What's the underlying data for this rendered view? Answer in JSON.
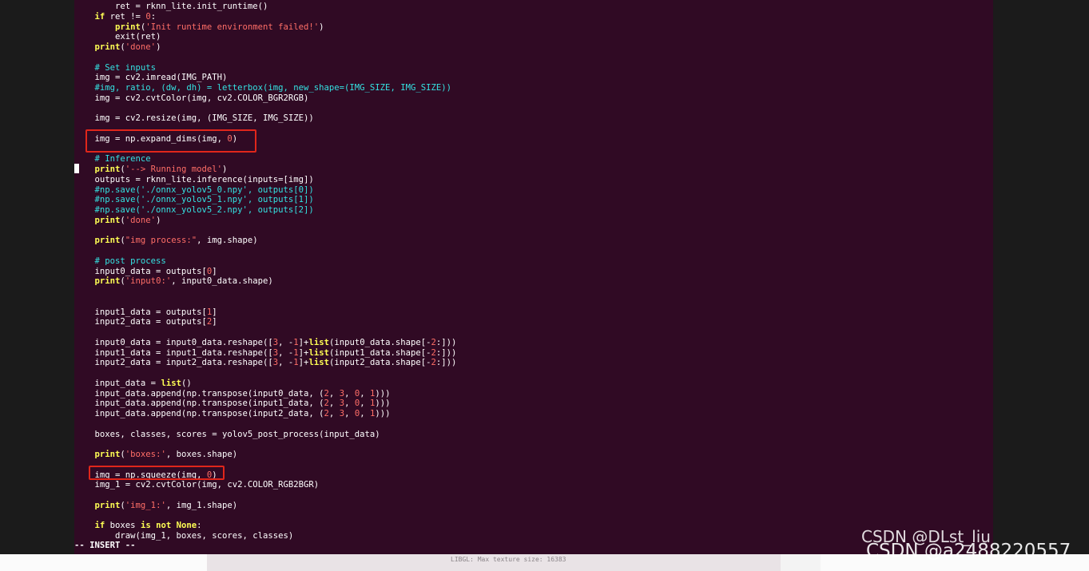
{
  "editor": {
    "mode": "-- INSERT --",
    "lines": [
      [
        {
          "t": "plain",
          "v": "        ret = rknn_lite.init_runtime()"
        }
      ],
      [
        {
          "t": "plain",
          "v": "    "
        },
        {
          "t": "kw",
          "v": "if"
        },
        {
          "t": "plain",
          "v": " ret != "
        },
        {
          "t": "num",
          "v": "0"
        },
        {
          "t": "plain",
          "v": ":"
        }
      ],
      [
        {
          "t": "plain",
          "v": "        "
        },
        {
          "t": "kw",
          "v": "print"
        },
        {
          "t": "plain",
          "v": "("
        },
        {
          "t": "str",
          "v": "'Init runtime environment failed!'"
        },
        {
          "t": "plain",
          "v": ")"
        }
      ],
      [
        {
          "t": "plain",
          "v": "        exit(ret)"
        }
      ],
      [
        {
          "t": "plain",
          "v": "    "
        },
        {
          "t": "kw",
          "v": "print"
        },
        {
          "t": "plain",
          "v": "("
        },
        {
          "t": "str",
          "v": "'done'"
        },
        {
          "t": "plain",
          "v": ")"
        }
      ],
      [],
      [
        {
          "t": "plain",
          "v": "    "
        },
        {
          "t": "cm",
          "v": "# Set inputs"
        }
      ],
      [
        {
          "t": "plain",
          "v": "    img = cv2.imread(IMG_PATH)"
        }
      ],
      [
        {
          "t": "plain",
          "v": "    "
        },
        {
          "t": "cm",
          "v": "#img, ratio, (dw, dh) = letterbox(img, new_shape=(IMG_SIZE, IMG_SIZE))"
        }
      ],
      [
        {
          "t": "plain",
          "v": "    img = cv2.cvtColor(img, cv2.COLOR_BGR2RGB)"
        }
      ],
      [],
      [
        {
          "t": "plain",
          "v": "    img = cv2.resize(img, (IMG_SIZE, IMG_SIZE))"
        }
      ],
      [],
      [
        {
          "t": "plain",
          "v": "    img = np.expand_dims(img, "
        },
        {
          "t": "num",
          "v": "0"
        },
        {
          "t": "plain",
          "v": ")"
        }
      ],
      [],
      [
        {
          "t": "plain",
          "v": "    "
        },
        {
          "t": "cm",
          "v": "# Inference"
        }
      ],
      [
        {
          "t": "plain",
          "v": "    "
        },
        {
          "t": "kw",
          "v": "print"
        },
        {
          "t": "plain",
          "v": "("
        },
        {
          "t": "str",
          "v": "'--> Running model'"
        },
        {
          "t": "plain",
          "v": ")"
        }
      ],
      [
        {
          "t": "plain",
          "v": "    outputs = rknn_lite.inference(inputs=[img])"
        }
      ],
      [
        {
          "t": "plain",
          "v": "    "
        },
        {
          "t": "cm",
          "v": "#np.save('./onnx_yolov5_0.npy', outputs[0])"
        }
      ],
      [
        {
          "t": "plain",
          "v": "    "
        },
        {
          "t": "cm",
          "v": "#np.save('./onnx_yolov5_1.npy', outputs[1])"
        }
      ],
      [
        {
          "t": "plain",
          "v": "    "
        },
        {
          "t": "cm",
          "v": "#np.save('./onnx_yolov5_2.npy', outputs[2])"
        }
      ],
      [
        {
          "t": "plain",
          "v": "    "
        },
        {
          "t": "kw",
          "v": "print"
        },
        {
          "t": "plain",
          "v": "("
        },
        {
          "t": "str",
          "v": "'done'"
        },
        {
          "t": "plain",
          "v": ")"
        }
      ],
      [],
      [
        {
          "t": "plain",
          "v": "    "
        },
        {
          "t": "kw",
          "v": "print"
        },
        {
          "t": "plain",
          "v": "("
        },
        {
          "t": "str",
          "v": "\"img process:\""
        },
        {
          "t": "plain",
          "v": ", img.shape)"
        }
      ],
      [],
      [
        {
          "t": "plain",
          "v": "    "
        },
        {
          "t": "cm",
          "v": "# post process"
        }
      ],
      [
        {
          "t": "plain",
          "v": "    input0_data = outputs["
        },
        {
          "t": "num",
          "v": "0"
        },
        {
          "t": "plain",
          "v": "]"
        }
      ],
      [
        {
          "t": "plain",
          "v": "    "
        },
        {
          "t": "kw",
          "v": "print"
        },
        {
          "t": "plain",
          "v": "("
        },
        {
          "t": "str",
          "v": "'input0:'"
        },
        {
          "t": "plain",
          "v": ", input0_data.shape)"
        }
      ],
      [],
      [],
      [
        {
          "t": "plain",
          "v": "    input1_data = outputs["
        },
        {
          "t": "num",
          "v": "1"
        },
        {
          "t": "plain",
          "v": "]"
        }
      ],
      [
        {
          "t": "plain",
          "v": "    input2_data = outputs["
        },
        {
          "t": "num",
          "v": "2"
        },
        {
          "t": "plain",
          "v": "]"
        }
      ],
      [],
      [
        {
          "t": "plain",
          "v": "    input0_data = input0_data.reshape(["
        },
        {
          "t": "num",
          "v": "3"
        },
        {
          "t": "plain",
          "v": ", -"
        },
        {
          "t": "num",
          "v": "1"
        },
        {
          "t": "plain",
          "v": "]+"
        },
        {
          "t": "kw",
          "v": "list"
        },
        {
          "t": "plain",
          "v": "(input0_data.shape[-"
        },
        {
          "t": "num",
          "v": "2"
        },
        {
          "t": "plain",
          "v": ":]))"
        }
      ],
      [
        {
          "t": "plain",
          "v": "    input1_data = input1_data.reshape(["
        },
        {
          "t": "num",
          "v": "3"
        },
        {
          "t": "plain",
          "v": ", -"
        },
        {
          "t": "num",
          "v": "1"
        },
        {
          "t": "plain",
          "v": "]+"
        },
        {
          "t": "kw",
          "v": "list"
        },
        {
          "t": "plain",
          "v": "(input1_data.shape[-"
        },
        {
          "t": "num",
          "v": "2"
        },
        {
          "t": "plain",
          "v": ":]))"
        }
      ],
      [
        {
          "t": "plain",
          "v": "    input2_data = input2_data.reshape(["
        },
        {
          "t": "num",
          "v": "3"
        },
        {
          "t": "plain",
          "v": ", -"
        },
        {
          "t": "num",
          "v": "1"
        },
        {
          "t": "plain",
          "v": "]+"
        },
        {
          "t": "kw",
          "v": "list"
        },
        {
          "t": "plain",
          "v": "(input2_data.shape[-"
        },
        {
          "t": "num",
          "v": "2"
        },
        {
          "t": "plain",
          "v": ":]))"
        }
      ],
      [],
      [
        {
          "t": "plain",
          "v": "    input_data = "
        },
        {
          "t": "kw",
          "v": "list"
        },
        {
          "t": "plain",
          "v": "()"
        }
      ],
      [
        {
          "t": "plain",
          "v": "    input_data.append(np.transpose(input0_data, ("
        },
        {
          "t": "num",
          "v": "2"
        },
        {
          "t": "plain",
          "v": ", "
        },
        {
          "t": "num",
          "v": "3"
        },
        {
          "t": "plain",
          "v": ", "
        },
        {
          "t": "num",
          "v": "0"
        },
        {
          "t": "plain",
          "v": ", "
        },
        {
          "t": "num",
          "v": "1"
        },
        {
          "t": "plain",
          "v": ")))"
        }
      ],
      [
        {
          "t": "plain",
          "v": "    input_data.append(np.transpose(input1_data, ("
        },
        {
          "t": "num",
          "v": "2"
        },
        {
          "t": "plain",
          "v": ", "
        },
        {
          "t": "num",
          "v": "3"
        },
        {
          "t": "plain",
          "v": ", "
        },
        {
          "t": "num",
          "v": "0"
        },
        {
          "t": "plain",
          "v": ", "
        },
        {
          "t": "num",
          "v": "1"
        },
        {
          "t": "plain",
          "v": ")))"
        }
      ],
      [
        {
          "t": "plain",
          "v": "    input_data.append(np.transpose(input2_data, ("
        },
        {
          "t": "num",
          "v": "2"
        },
        {
          "t": "plain",
          "v": ", "
        },
        {
          "t": "num",
          "v": "3"
        },
        {
          "t": "plain",
          "v": ", "
        },
        {
          "t": "num",
          "v": "0"
        },
        {
          "t": "plain",
          "v": ", "
        },
        {
          "t": "num",
          "v": "1"
        },
        {
          "t": "plain",
          "v": ")))"
        }
      ],
      [],
      [
        {
          "t": "plain",
          "v": "    boxes, classes, scores = yolov5_post_process(input_data)"
        }
      ],
      [],
      [
        {
          "t": "plain",
          "v": "    "
        },
        {
          "t": "kw",
          "v": "print"
        },
        {
          "t": "plain",
          "v": "("
        },
        {
          "t": "str",
          "v": "'boxes:'"
        },
        {
          "t": "plain",
          "v": ", boxes.shape)"
        }
      ],
      [],
      [
        {
          "t": "plain",
          "v": "    img = np.squeeze(img, "
        },
        {
          "t": "num",
          "v": "0"
        },
        {
          "t": "plain",
          "v": ")"
        }
      ],
      [
        {
          "t": "plain",
          "v": "    img_1 = cv2.cvtColor(img, cv2.COLOR_RGB2BGR)"
        }
      ],
      [],
      [
        {
          "t": "plain",
          "v": "    "
        },
        {
          "t": "kw",
          "v": "print"
        },
        {
          "t": "plain",
          "v": "("
        },
        {
          "t": "str",
          "v": "'img_1:'"
        },
        {
          "t": "plain",
          "v": ", img_1.shape)"
        }
      ],
      [],
      [
        {
          "t": "plain",
          "v": "    "
        },
        {
          "t": "kw",
          "v": "if"
        },
        {
          "t": "plain",
          "v": " boxes "
        },
        {
          "t": "kw",
          "v": "is not"
        },
        {
          "t": "plain",
          "v": " "
        },
        {
          "t": "kw",
          "v": "None"
        },
        {
          "t": "plain",
          "v": ":"
        }
      ],
      [
        {
          "t": "plain",
          "v": "        draw(img_1, boxes, scores, classes)"
        }
      ]
    ]
  },
  "background_terminal": {
    "log_text": "LIBGL: Max texture size: 16383"
  },
  "watermarks": {
    "line1": "CSDN @DLst_liu",
    "line2": "CSDN @a2488220557"
  },
  "colors": {
    "terminal_bg": "#300a24",
    "keyword": "#ffff54",
    "string": "#ff6e67",
    "comment": "#34e2e2",
    "text": "#ffffff",
    "highlight_box": "#e0261b"
  }
}
